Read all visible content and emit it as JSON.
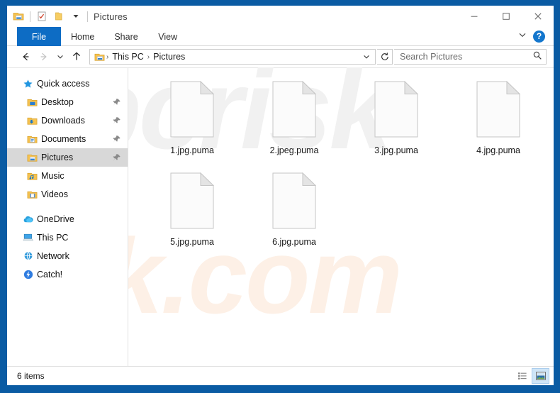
{
  "window": {
    "title": "Pictures",
    "frame_color": "#0a5ba3",
    "quick_access": [
      {
        "name": "properties-pane-icon",
        "label": "Properties"
      },
      {
        "name": "checklist-icon",
        "label": "Properties"
      },
      {
        "name": "new-folder-icon",
        "label": "New folder"
      },
      {
        "name": "chevron-down-icon",
        "label": "Customize Quick Access Toolbar"
      }
    ],
    "controls": {
      "minimize": "—",
      "maximize": "□",
      "close": "✕"
    }
  },
  "ribbon": {
    "tabs": [
      {
        "label": "File",
        "active": true
      },
      {
        "label": "Home",
        "active": false
      },
      {
        "label": "Share",
        "active": false
      },
      {
        "label": "View",
        "active": false
      }
    ],
    "expand_label": "⌄",
    "help_label": "?"
  },
  "address": {
    "back_label": "←",
    "forward_label": "→",
    "recent_label": "⌄",
    "up_label": "↑",
    "breadcrumbs": [
      "This PC",
      "Pictures"
    ],
    "separator": "›",
    "dropdown_label": "⌄",
    "refresh_label": "↻"
  },
  "search": {
    "value": "",
    "placeholder": "Search Pictures",
    "icon": "search-icon"
  },
  "sidebar": {
    "groups": [
      {
        "name": "quick-access",
        "header": {
          "label": "Quick access",
          "icon": "star-icon"
        },
        "items": [
          {
            "label": "Desktop",
            "icon": "desktop-folder-icon",
            "pinned": true,
            "selected": false
          },
          {
            "label": "Downloads",
            "icon": "downloads-folder-icon",
            "pinned": true,
            "selected": false
          },
          {
            "label": "Documents",
            "icon": "documents-folder-icon",
            "pinned": true,
            "selected": false
          },
          {
            "label": "Pictures",
            "icon": "pictures-folder-icon",
            "pinned": true,
            "selected": true
          },
          {
            "label": "Music",
            "icon": "music-folder-icon",
            "pinned": false,
            "selected": false
          },
          {
            "label": "Videos",
            "icon": "videos-folder-icon",
            "pinned": false,
            "selected": false
          }
        ]
      },
      {
        "name": "roots",
        "items": [
          {
            "label": "OneDrive",
            "icon": "onedrive-cloud-icon",
            "pinned": false,
            "selected": false
          },
          {
            "label": "This PC",
            "icon": "this-pc-icon",
            "pinned": false,
            "selected": false
          },
          {
            "label": "Network",
            "icon": "network-icon",
            "pinned": false,
            "selected": false
          },
          {
            "label": "Catch!",
            "icon": "catch-lightning-icon",
            "pinned": false,
            "selected": false
          }
        ]
      }
    ]
  },
  "files": [
    {
      "name": "1.jpg.puma",
      "icon": "blank-document-icon"
    },
    {
      "name": "2.jpeg.puma",
      "icon": "blank-document-icon"
    },
    {
      "name": "3.jpg.puma",
      "icon": "blank-document-icon"
    },
    {
      "name": "4.jpg.puma",
      "icon": "blank-document-icon"
    },
    {
      "name": "5.jpg.puma",
      "icon": "blank-document-icon"
    },
    {
      "name": "6.jpg.puma",
      "icon": "blank-document-icon"
    }
  ],
  "status": {
    "item_count": "6 items",
    "views": [
      {
        "name": "details-view-button",
        "label": "Details view",
        "active": false
      },
      {
        "name": "large-icons-view-button",
        "label": "Large icons view",
        "active": true
      }
    ]
  },
  "watermark": {
    "grey_text": "pcrisk",
    "peach_text": "risk.com"
  }
}
